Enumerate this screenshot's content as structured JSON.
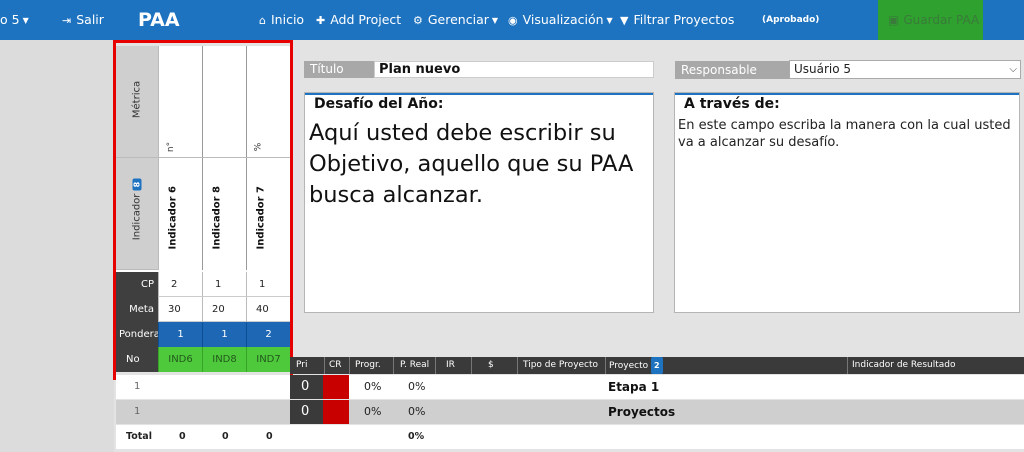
{
  "navbar": {
    "left_cut": "o 5",
    "exit_label": "Salir",
    "brand": "PAA",
    "home_label": "Inicio",
    "add_project_label": "Add Project",
    "manage_label": "Gerenciar",
    "view_label": "Visualización",
    "filter_label": "Filtrar Proyectos",
    "status": "(Aprobado)",
    "save_label": "Guardar PAA"
  },
  "matrix": {
    "metric_label": "Métrica",
    "indicator_label": "Indicador",
    "indicator_count": "8",
    "row_labels": {
      "cp": "CP",
      "meta": "Meta",
      "pond": "Ponderación",
      "no": "No"
    },
    "columns": [
      {
        "unit": "n°",
        "name": "Indicador 6",
        "cp": "2",
        "meta": "30",
        "pond": "1",
        "no": "IND6"
      },
      {
        "unit": "",
        "name": "Indicador 8",
        "cp": "1",
        "meta": "20",
        "pond": "1",
        "no": "IND8"
      },
      {
        "unit": "%",
        "name": "Indicador 7",
        "cp": "1",
        "meta": "40",
        "pond": "2",
        "no": "IND7"
      }
    ]
  },
  "form": {
    "title_label": "Título",
    "title_value": "Plan nuevo",
    "responsible_label": "Responsable",
    "responsible_value": "Usuário 5"
  },
  "challenge": {
    "heading": "Desafío del Año:",
    "text": "Aquí usted debe escribir su Objetivo, aquello que su PAA busca alcanzar."
  },
  "through": {
    "heading": "A través de:",
    "text": "En este campo escriba la manera con la cual usted va a alcanzar su desafío."
  },
  "table": {
    "headers": {
      "pri": "Pri",
      "cr": "CR",
      "progr": "Progr.",
      "preal": "P. Real",
      "ir": "IR",
      "money": "$",
      "type": "Tipo de Proyecto",
      "project": "Proyecto",
      "project_count": "2",
      "indicator": "Indicador de Resultado"
    },
    "rows": [
      {
        "num": "1",
        "pri": "0",
        "progr": "0%",
        "preal": "0%",
        "project": "Etapa 1"
      },
      {
        "num": "1",
        "pri": "0",
        "progr": "0%",
        "preal": "0%",
        "project": "Proyectos"
      }
    ],
    "total": {
      "label": "Total",
      "v1": "0",
      "v2": "0",
      "v3": "0",
      "preal": "0%"
    }
  },
  "colors": {
    "navbar": "#1e73c0",
    "save": "#2ea12e",
    "pond": "#1e67b4",
    "no": "#4ec93c",
    "cr": "#c80000",
    "highlight": "#e60000"
  }
}
